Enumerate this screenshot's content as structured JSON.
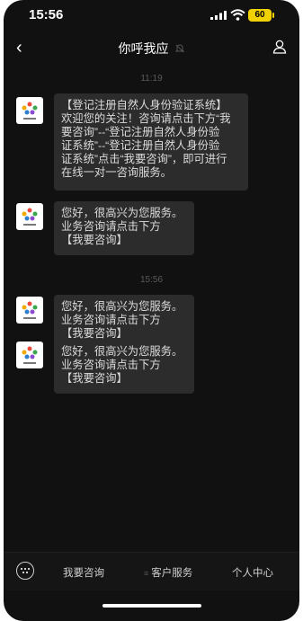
{
  "status_bar": {
    "time": "15:56",
    "battery": "60"
  },
  "nav": {
    "title": "你呼我应"
  },
  "timestamps": [
    "11:19",
    "15:56"
  ],
  "messages": [
    {
      "lines": [
        "【登记注册自然人身份验证系统】",
        "欢迎您的关注！咨询请点击下方“我",
        "要咨询”--“登记注册自然人身份验",
        "证系统”--“登记注册自然人身份验",
        "证系统”点击“我要咨询”，即可进行",
        "在线一对一咨询服务。"
      ]
    },
    {
      "lines": [
        "您好，很高兴为您服务。",
        "业务咨询请点击下方",
        "【我要咨询】"
      ]
    },
    {
      "lines": [
        "您好，很高兴为您服务。",
        "业务咨询请点击下方",
        "【我要咨询】"
      ]
    },
    {
      "lines": [
        "您好，很高兴为您服务。",
        "业务咨询请点击下方",
        "【我要咨询】"
      ]
    }
  ],
  "menu": {
    "items": [
      "我要咨询",
      "客户服务",
      "个人中心"
    ],
    "separator": "≡"
  },
  "colors": {
    "background": "#111111",
    "bubble": "#2c2c2c",
    "battery": "#f2d100"
  }
}
